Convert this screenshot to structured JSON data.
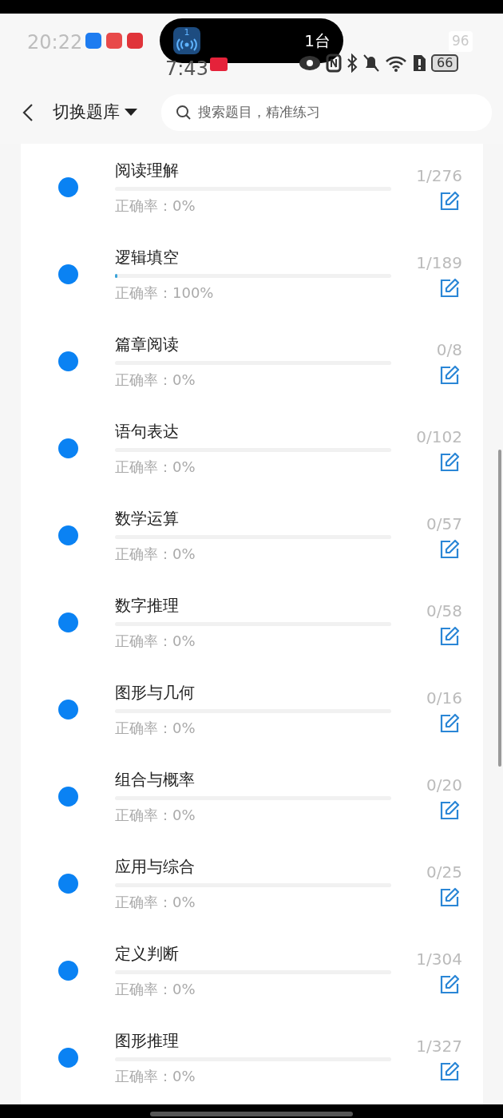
{
  "status_bar": {
    "ghost_time": "20:22",
    "ghost_battery": "96",
    "island_badge": "1",
    "island_text": "1台",
    "time": "7:43",
    "battery": "66"
  },
  "header": {
    "title": "切换题库",
    "search": {
      "placeholder": "搜索题目，精准练习"
    }
  },
  "items": [
    {
      "name": "阅读理解",
      "accuracy": "正确率：0%",
      "count": "1/276",
      "level": 0
    },
    {
      "name": "逻辑填空",
      "accuracy": "正确率：100%",
      "count": "1/189",
      "level": 0.01
    },
    {
      "name": "篇章阅读",
      "accuracy": "正确率：0%",
      "count": "0/8",
      "level": 0
    },
    {
      "name": "语句表达",
      "accuracy": "正确率：0%",
      "count": "0/102",
      "level": 0
    },
    {
      "name": "数学运算",
      "accuracy": "正确率：0%",
      "count": "0/57",
      "level": 0
    },
    {
      "name": "数字推理",
      "accuracy": "正确率：0%",
      "count": "0/58",
      "level": 0
    },
    {
      "name": "图形与几何",
      "accuracy": "正确率：0%",
      "count": "0/16",
      "level": 0
    },
    {
      "name": "组合与概率",
      "accuracy": "正确率：0%",
      "count": "0/20",
      "level": 0
    },
    {
      "name": "应用与综合",
      "accuracy": "正确率：0%",
      "count": "0/25",
      "level": 0
    },
    {
      "name": "定义判断",
      "accuracy": "正确率：0%",
      "count": "1/304",
      "level": 0
    },
    {
      "name": "图形推理",
      "accuracy": "正确率：0%",
      "count": "1/327",
      "level": 0
    }
  ]
}
